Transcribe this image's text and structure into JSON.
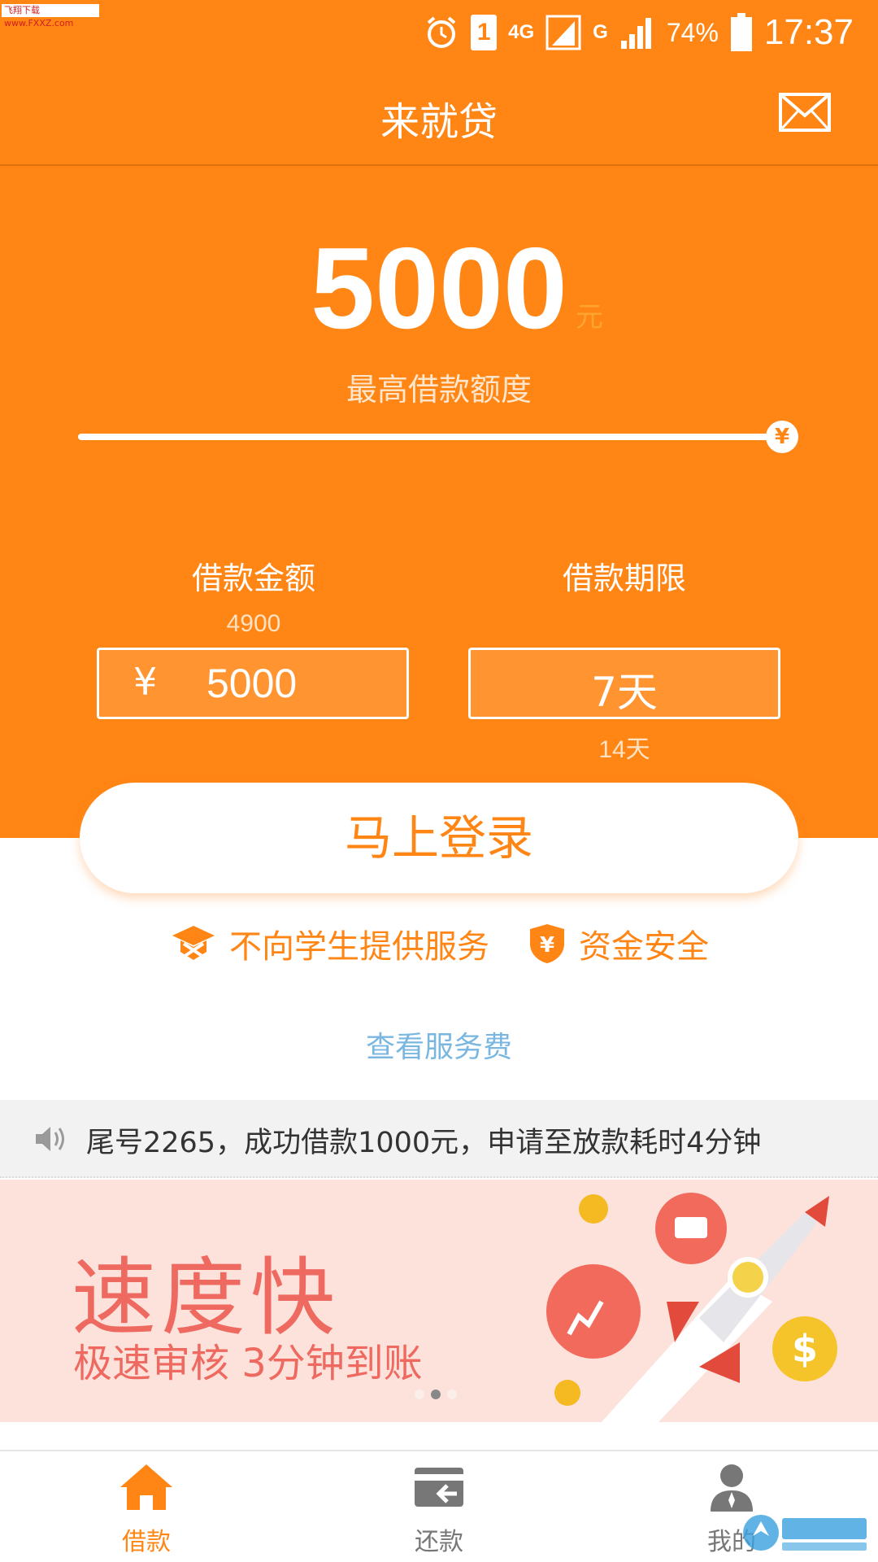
{
  "status_bar": {
    "watermark": "飞翔下载 www.FXXZ.com",
    "network": "4G",
    "network2": "G",
    "sim": "1",
    "battery": "74%",
    "time": "17:37"
  },
  "header": {
    "title": "来就贷"
  },
  "limit": {
    "amount": "5000",
    "unit": "元",
    "label": "最高借款额度",
    "slider_fraction": 1.0,
    "slider_symbol": "¥"
  },
  "loan_amount": {
    "title": "借款金额",
    "hint_above": "4900",
    "currency": "¥",
    "value": "5000"
  },
  "loan_term": {
    "title": "借款期限",
    "value": "7天",
    "hint_below": "14天"
  },
  "login_button": "马上登录",
  "features": [
    {
      "icon": "graduation-cap-icon",
      "label": "不向学生提供服务"
    },
    {
      "icon": "shield-yen-icon",
      "label": "资金安全"
    }
  ],
  "fee_link": "查看服务费",
  "notice": {
    "icon": "speaker-icon",
    "text": "尾号2265，成功借款1000元，申请至放款耗时4分钟"
  },
  "banner": {
    "title": "速度快",
    "subtitle": "极速审核 3分钟到账",
    "dots": 3,
    "active_dot": 1
  },
  "tabbar": [
    {
      "label": "借款",
      "icon": "home-icon",
      "active": true
    },
    {
      "label": "还款",
      "icon": "card-return-icon",
      "active": false
    },
    {
      "label": "我的",
      "icon": "user-icon",
      "active": false
    }
  ],
  "colors": {
    "brand": "#ff8514",
    "banner_bg": "#fde2dc",
    "banner_text": "#ee6a60",
    "link": "#7ab7e0"
  }
}
